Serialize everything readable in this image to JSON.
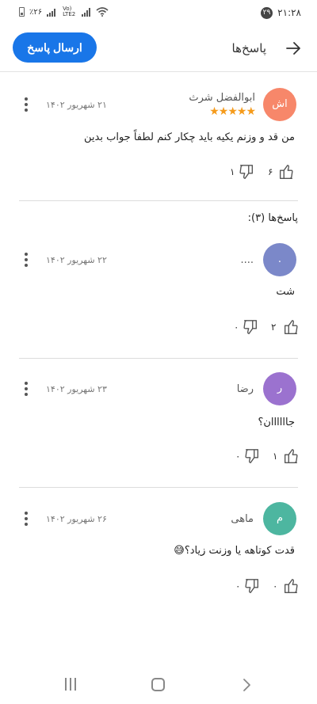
{
  "status_bar": {
    "time": "۲۱:۲۸",
    "notification_count": "۲۹",
    "battery": "٪۲۶",
    "network": "Vo) LTE2"
  },
  "app_bar": {
    "title": "پاسخ‌ها",
    "send_button": "ارسال پاسخ"
  },
  "main_comment": {
    "avatar_initials": "اش",
    "avatar_color": "#f7876a",
    "author": "ابوالفضل شرث",
    "rating": 5,
    "stars": "★★★★★",
    "date": "۲۱ شهریور ۱۴۰۲",
    "text": "من قد و وزنم یکیه باید چکار کنم لطفاً جواب بدین",
    "likes": "۶",
    "dislikes": "۱"
  },
  "replies_title": "پاسخ‌ها (۳):",
  "replies": [
    {
      "avatar_initials": ".",
      "avatar_color": "#7b88c9",
      "author": "....",
      "date": "۲۲ شهریور ۱۴۰۲",
      "text": "شت",
      "likes": "۲",
      "dislikes": "۰"
    },
    {
      "avatar_initials": "ر",
      "avatar_color": "#9b72cf",
      "author": "رضا",
      "date": "۲۳ شهریور ۱۴۰۲",
      "text": "جاااااان؟",
      "likes": "۱",
      "dislikes": "۰"
    },
    {
      "avatar_initials": "م",
      "avatar_color": "#4db6a0",
      "author": "ماهی",
      "date": "۲۶ شهریور ۱۴۰۲",
      "text": "قدت کوتاهه یا وزنت زیاد؟😅",
      "likes": "۰",
      "dislikes": "۰"
    }
  ]
}
